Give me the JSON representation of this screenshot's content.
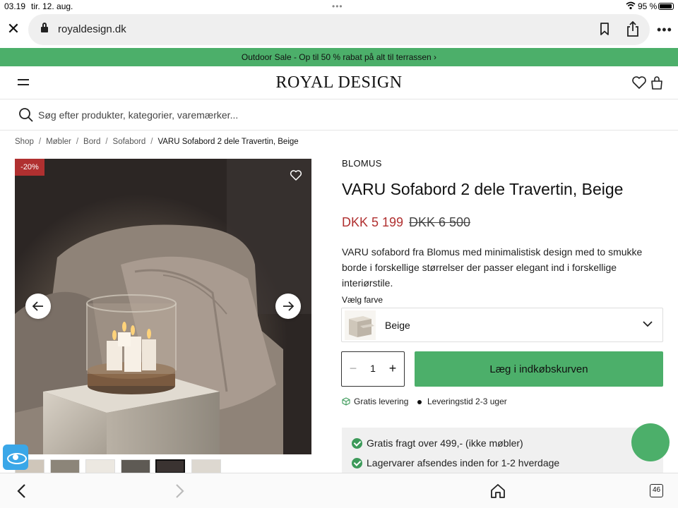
{
  "status_bar": {
    "time": "03.19",
    "date": "tir. 12. aug.",
    "dots": "•••",
    "battery_percent": "95 %"
  },
  "browser": {
    "url": "royaldesign.dk",
    "tabs_count": "46"
  },
  "promo": {
    "text": "Outdoor Sale - Op til 50 % rabat på alt til terrassen ›"
  },
  "header": {
    "logo": "ROYAL DESIGN"
  },
  "search": {
    "placeholder": "Søg efter produkter, kategorier, varemærker..."
  },
  "breadcrumb": {
    "items": [
      "Shop",
      "Møbler",
      "Bord",
      "Sofabord"
    ],
    "current": "VARU Sofabord 2 dele Travertin, Beige",
    "separator": "/"
  },
  "gallery": {
    "badge": "-20%",
    "thumbnail_count": 6,
    "active_thumbnail": 5
  },
  "product": {
    "brand": "BLOMUS",
    "title": "VARU Sofabord 2 dele Travertin, Beige",
    "price": "DKK 5 199",
    "old_price": "DKK 6 500",
    "description": "VARU sofabord fra Blomus med minimalistisk design med to smukke borde i forskellige størrelser der passer elegant ind i forskellige interiørstile.",
    "color_label": "Vælg farve",
    "color_value": "Beige",
    "quantity": "1",
    "add_to_cart": "Læg i indkøbskurven",
    "free_delivery": "Gratis levering",
    "lead_time": "Leveringstid 2-3 uger",
    "usps": [
      "Gratis fragt over 499,- (ikke møbler)",
      "Lagervarer afsendes inden for 1-2 hverdage"
    ]
  },
  "colors": {
    "accent_green": "#4caf6a",
    "sale_red": "#b03030",
    "check_green": "#3d9a5a"
  }
}
